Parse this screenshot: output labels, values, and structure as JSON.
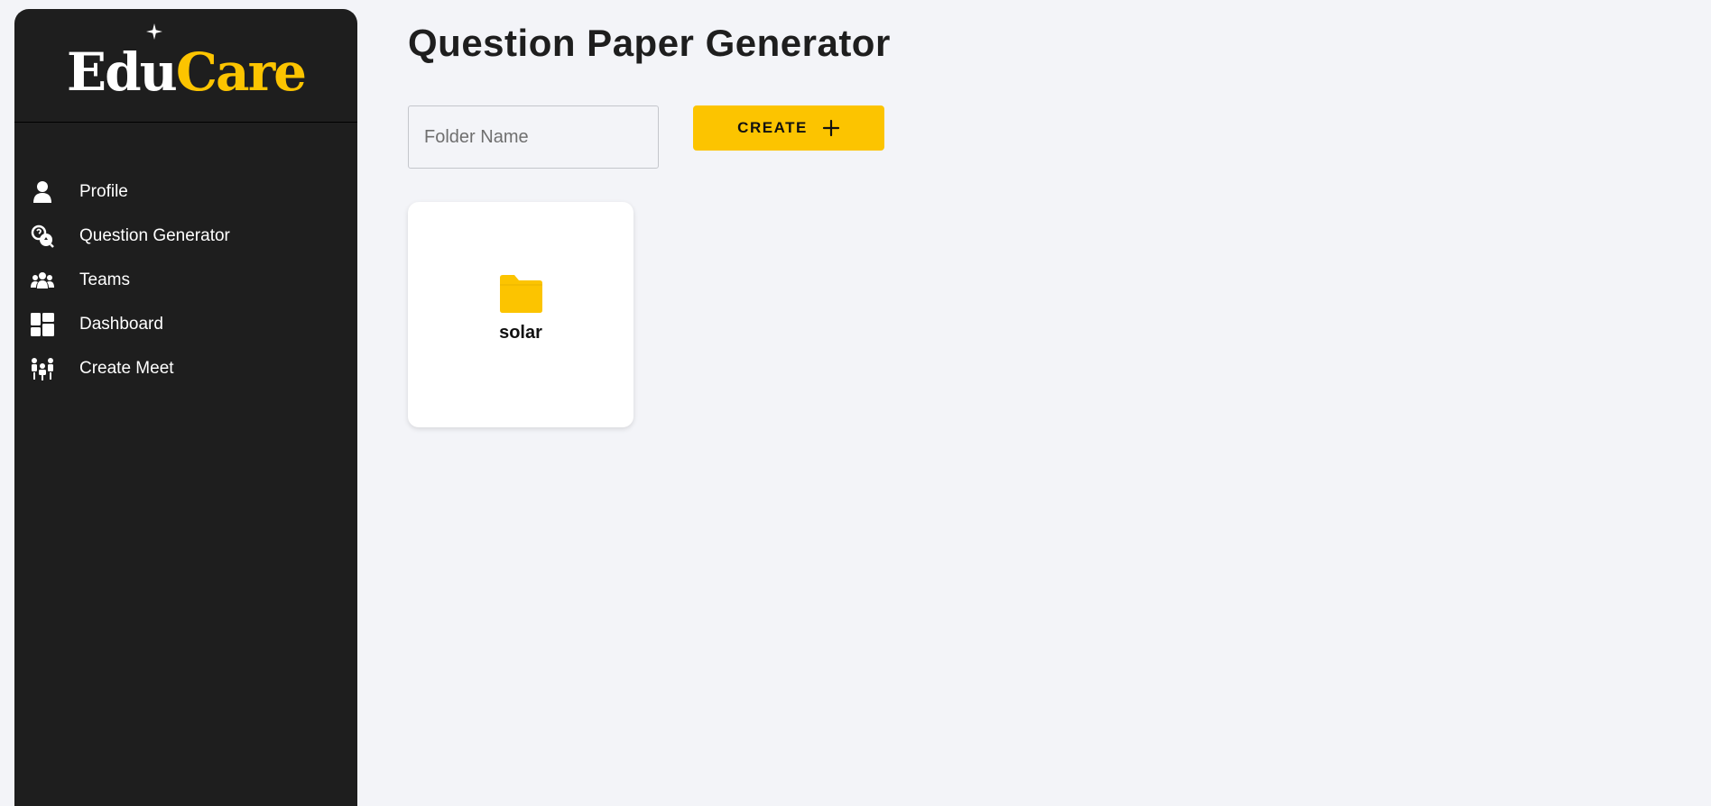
{
  "brand": {
    "part1": "Edu",
    "part2": "Care"
  },
  "colors": {
    "accent": "#fcc400",
    "sidebar_bg": "#1e1e1e",
    "page_bg": "#f3f4f8"
  },
  "sidebar": {
    "items": [
      {
        "label": "Profile",
        "icon": "user-icon"
      },
      {
        "label": "Question Generator",
        "icon": "question-generator-icon"
      },
      {
        "label": "Teams",
        "icon": "team-icon"
      },
      {
        "label": "Dashboard",
        "icon": "dashboard-icon"
      },
      {
        "label": "Create Meet",
        "icon": "meeting-icon"
      }
    ]
  },
  "main": {
    "title": "Question Paper Generator",
    "folder_input": {
      "placeholder": "Folder Name",
      "value": ""
    },
    "create_button": {
      "label": "CREATE",
      "icon": "plus-icon"
    },
    "folders": [
      {
        "name": "solar",
        "icon": "folder-icon"
      }
    ]
  }
}
